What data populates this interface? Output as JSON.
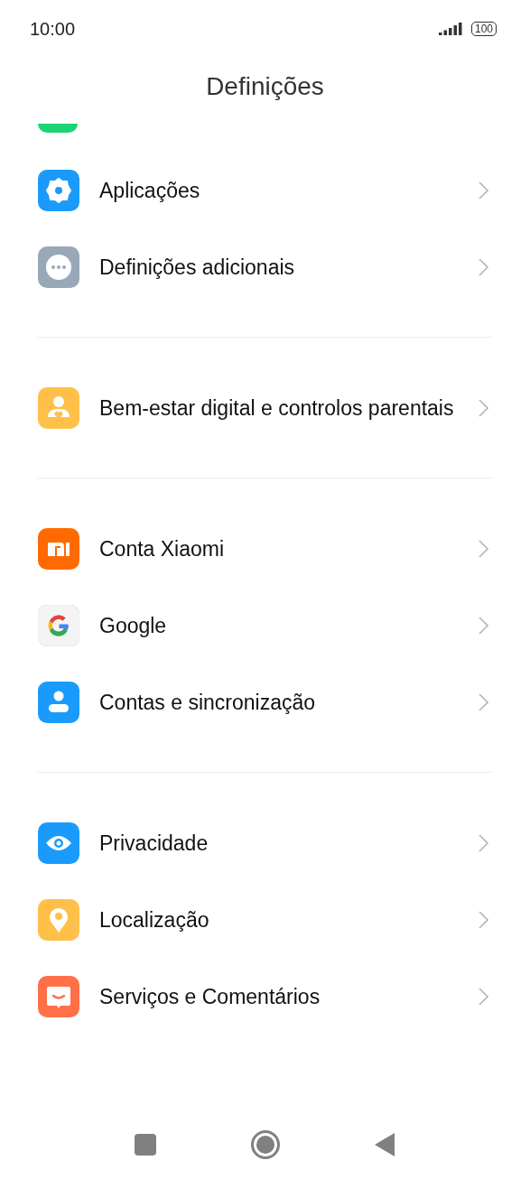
{
  "status_bar": {
    "time": "10:00",
    "battery": "100"
  },
  "title": "Definições",
  "groups": [
    {
      "items": [
        {
          "label": "Aplicações",
          "kind": "gear",
          "color": "#1a9bfc"
        },
        {
          "label": "Definições adicionais",
          "kind": "dots",
          "color": "#98a8b8"
        }
      ]
    },
    {
      "items": [
        {
          "label": "Bem-estar digital e controlos parentais",
          "kind": "wellbeing",
          "color": "#ffc04a"
        }
      ]
    },
    {
      "items": [
        {
          "label": "Conta Xiaomi",
          "kind": "mi",
          "color": "#ff6a00"
        },
        {
          "label": "Google",
          "kind": "google",
          "color": "#f4f4f4"
        },
        {
          "label": "Contas e sincronização",
          "kind": "person",
          "color": "#1a9bfc"
        }
      ]
    },
    {
      "items": [
        {
          "label": "Privacidade",
          "kind": "eye",
          "color": "#1a9bfc"
        },
        {
          "label": "Localização",
          "kind": "pin",
          "color": "#ffc04a"
        },
        {
          "label": "Serviços e Comentários",
          "kind": "chat",
          "color": "#ff7048"
        }
      ]
    }
  ]
}
